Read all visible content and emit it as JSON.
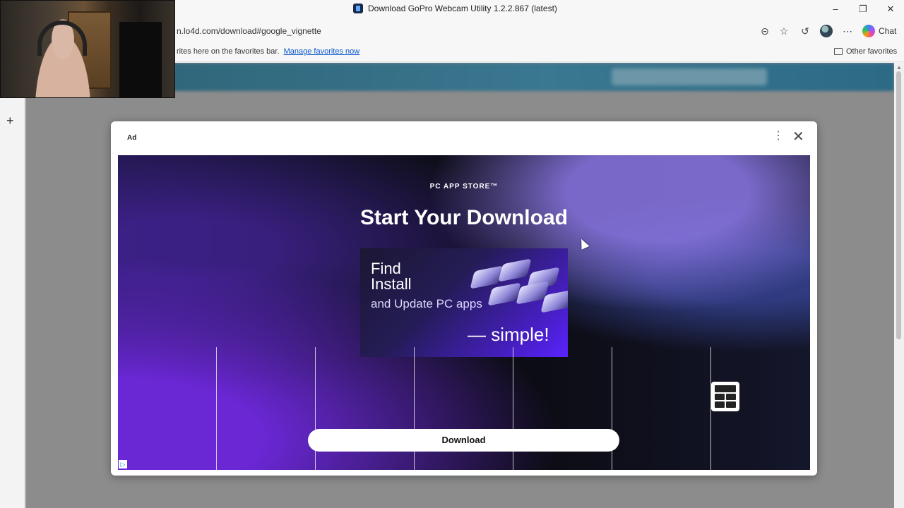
{
  "window": {
    "title": "Download GoPro Webcam Utility 1.2.2.867 (latest)",
    "minimize": "–",
    "maximize": "❐",
    "close": "✕"
  },
  "address_bar": {
    "url": "n.lo4d.com/download#google_vignette",
    "chat_label": "Chat"
  },
  "favorites_bar": {
    "text": "rites here on the favorites bar.",
    "manage_link": "Manage favorites now",
    "other_favorites": "Other favorites"
  },
  "sidebar": {
    "new_tab": "+"
  },
  "ad_modal": {
    "label": "Ad",
    "menu_icon": "⋮",
    "close_icon": "✕",
    "brand": "PC APP STORE™",
    "headline": "Start Your Download",
    "promo_find": "Find",
    "promo_install": "Install",
    "promo_update": "and Update PC apps",
    "promo_simple": "— simple!",
    "download_label": "Download",
    "adchoices_icon": "▷"
  },
  "icons": [
    "reading-mode-icon",
    "favorite-star-icon",
    "history-icon",
    "profile-avatar",
    "more-icon",
    "copilot-icon",
    "folder-icon",
    "windows-logo-icon"
  ]
}
